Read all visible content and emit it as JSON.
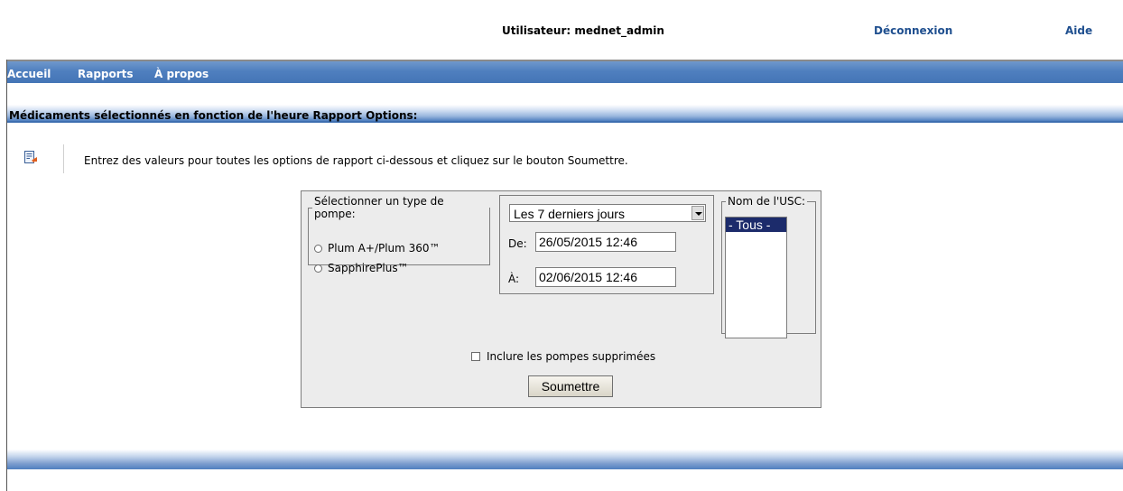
{
  "header": {
    "user_label": "Utilisateur: mednet_admin",
    "logout_label": "Déconnexion",
    "help_label": "Aide"
  },
  "nav": {
    "items": [
      {
        "label": "Accueil"
      },
      {
        "label": "Rapports"
      },
      {
        "label": "À propos"
      }
    ]
  },
  "section": {
    "title": "Médicaments sélectionnés en fonction de l'heure Rapport Options:"
  },
  "instructions": "Entrez des valeurs pour toutes les options de rapport ci-dessous et cliquez sur le bouton Soumettre.",
  "form": {
    "pump_legend": "Sélectionner un type de pompe:",
    "pump_options": [
      {
        "label": "Plum A+/Plum 360™"
      },
      {
        "label": "SapphirePlus™"
      }
    ],
    "period_select": "Les 7 derniers jours",
    "from_label": "De:",
    "from_value": "26/05/2015 12:46",
    "to_label": "À:",
    "to_value": "02/06/2015 12:46",
    "usc_legend": "Nom de l'USC:",
    "usc_options": [
      {
        "label": "- Tous -",
        "selected": true
      }
    ],
    "include_deleted_label": "Inclure les pompes supprimées",
    "submit_label": "Soumettre"
  },
  "colors": {
    "nav_blue": "#4f7fbf",
    "link_blue": "#1f4f8f",
    "selected_option": "#1c2b6b"
  }
}
